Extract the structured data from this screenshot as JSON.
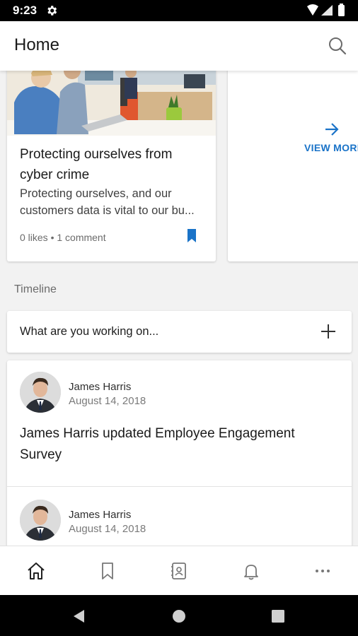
{
  "status": {
    "time": "9:23"
  },
  "header": {
    "title": "Home"
  },
  "news": {
    "title": "Protecting ourselves from cyber crime",
    "excerpt_line1": "Protecting ourselves, and our",
    "excerpt_line2": "customers data is vital to our bu...",
    "meta": "0 likes • 1 comment"
  },
  "more": {
    "label": "VIEW MORE"
  },
  "timeline": {
    "label": "Timeline",
    "compose_placeholder": "What are you working on..."
  },
  "posts": [
    {
      "author": "James Harris",
      "date": "August 14, 2018",
      "text": "James Harris updated Employee Engagement Survey"
    },
    {
      "author": "James Harris",
      "date": "August 14, 2018"
    }
  ],
  "nav": {
    "items": [
      "home-icon",
      "bookmark-icon",
      "contacts-icon",
      "bell-icon",
      "more-icon"
    ]
  },
  "colors": {
    "accent": "#1a73c8",
    "background": "#f2f2f2",
    "status_bar": "#000000"
  }
}
